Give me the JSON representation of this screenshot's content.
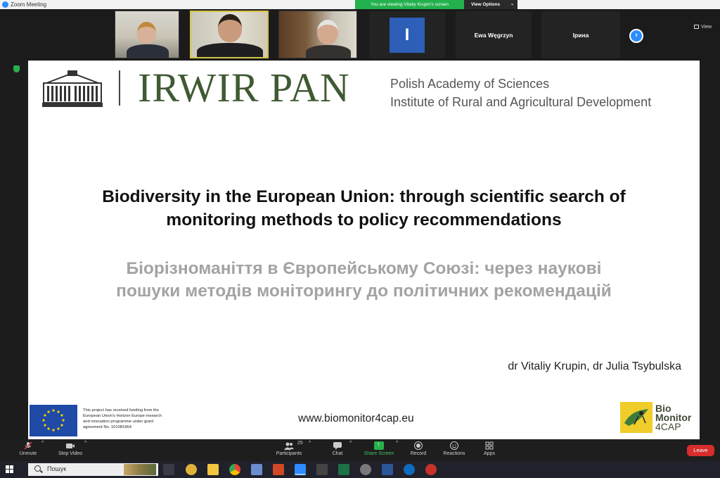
{
  "window": {
    "title": "Zoom Meeting"
  },
  "banner": {
    "viewing": "You are viewing Vitaliy Krupin's screen",
    "view_options": "View Options"
  },
  "participants": [
    {
      "type": "video"
    },
    {
      "type": "video",
      "active": true
    },
    {
      "type": "video"
    },
    {
      "type": "avatar",
      "initial": "I"
    },
    {
      "type": "name",
      "name": "Ewa Węgrzyn"
    },
    {
      "type": "name",
      "name": "Ірина"
    }
  ],
  "view_button": "View",
  "slide": {
    "logo_text": "IRWIR PAN",
    "org_line1": "Polish Academy of Sciences",
    "org_line2": "Institute of Rural and Agricultural Development",
    "title_en_1": "Biodiversity in the European Union: through scientific search of",
    "title_en_2": "monitoring methods to policy recommendations",
    "title_ua_1": "Біорізноманіття в Європейському Союзі: через наукові",
    "title_ua_2": "пошуки методів моніторингу до політичних рекомендацій",
    "authors": "dr Vitaliy Krupin, dr Julia Tsybulska",
    "funding_1": "This project has received funding from the",
    "funding_2": "European Union's Horizon Europe research",
    "funding_3": "and innovation programme under grant",
    "funding_4": "agreement No. 101081964",
    "url": "www.biomonitor4cap.eu",
    "bm_1": "Bio",
    "bm_2": "Monitor",
    "bm_3": "4CAP"
  },
  "toolbar": {
    "unmute": "Unmute",
    "stop_video": "Stop Video",
    "participants": "Participants",
    "participants_count": "25",
    "chat": "Chat",
    "share_screen": "Share Screen",
    "record": "Record",
    "reactions": "Reactions",
    "apps": "Apps",
    "leave": "Leave"
  },
  "taskbar": {
    "search_placeholder": "Пошук"
  },
  "colors": {
    "zoom_blue": "#2d8cff",
    "share_green": "#27b14d",
    "leave_red": "#d72d2d",
    "irwir_green": "#3f5a33"
  }
}
